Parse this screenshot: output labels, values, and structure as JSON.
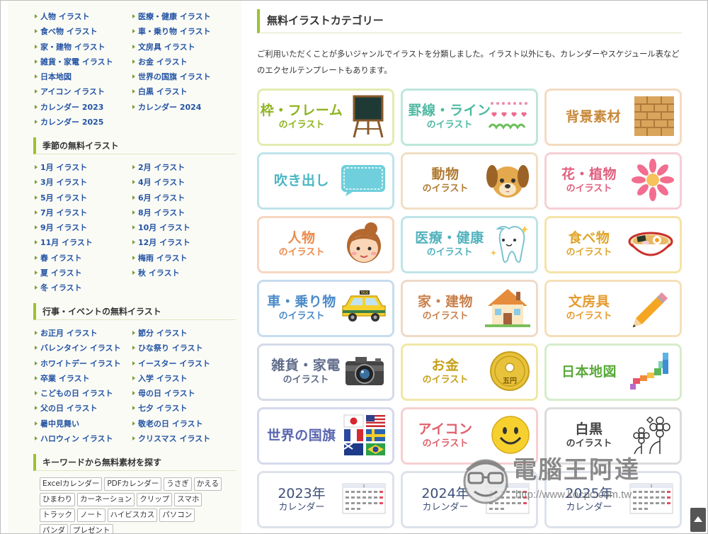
{
  "sidebar": {
    "top_links": [
      "人物 イラスト",
      "医療・健康 イラスト",
      "食べ物 イラスト",
      "車・乗り物 イラスト",
      "家・建物 イラスト",
      "文房具 イラスト",
      "雑貨・家電 イラスト",
      "お金 イラスト",
      "日本地図",
      "世界の国旗 イラスト",
      "アイコン イラスト",
      "白黒 イラスト",
      "カレンダー 2023",
      "カレンダー 2024",
      "カレンダー 2025"
    ],
    "season_title": "季節の無料イラスト",
    "season_links": [
      "1月 イラスト",
      "2月 イラスト",
      "3月 イラスト",
      "4月 イラスト",
      "5月 イラスト",
      "6月 イラスト",
      "7月 イラスト",
      "8月 イラスト",
      "9月 イラスト",
      "10月 イラスト",
      "11月 イラスト",
      "12月 イラスト",
      "春 イラスト",
      "梅雨 イラスト",
      "夏 イラスト",
      "秋 イラスト",
      "冬 イラスト"
    ],
    "event_title": "行事・イベントの無料イラスト",
    "event_links": [
      "お正月 イラスト",
      "節分 イラスト",
      "バレンタイン イラスト",
      "ひな祭り イラスト",
      "ホワイトデー イラスト",
      "イースター イラスト",
      "卒業 イラスト",
      "入学 イラスト",
      "こどもの日 イラスト",
      "母の日 イラスト",
      "父の日 イラスト",
      "七夕 イラスト",
      "暑中見舞い",
      "敬老の日 イラスト",
      "ハロウィン イラスト",
      "クリスマス イラスト"
    ],
    "keyword_title": "キーワードから無料素材を探す",
    "tags": [
      "Excelカレンダー",
      "PDFカレンダー",
      "うさぎ",
      "かえる",
      "ひまわり",
      "カーネーション",
      "クリップ",
      "スマホ",
      "トラック",
      "ノート",
      "ハイビスカス",
      "パソコン",
      "パンダ",
      "プレゼント"
    ]
  },
  "main": {
    "title": "無料イラストカテゴリー",
    "intro": "ご利用いただくことが多いジャンルでイラストを分類しました。イラスト以外にも、カレンダーやスケジュール表などのエクセルテンプレートもあります。",
    "cards": [
      {
        "title": "枠・フレーム",
        "sub": "のイラスト",
        "icon": "blackboard-icon",
        "border": "#e2ecb0",
        "color": "#8fb31f"
      },
      {
        "title": "罫線・ライン",
        "sub": "のイラスト",
        "icon": "line-border-icon",
        "border": "#bfe6dc",
        "color": "#4fb9a2"
      },
      {
        "title": "背景素材",
        "sub": "",
        "icon": "brick-wall-icon",
        "border": "#f3dcc2",
        "color": "#c8893a"
      },
      {
        "title": "吹き出し",
        "sub": "",
        "icon": "speech-bubble-icon",
        "border": "#bfe4ea",
        "color": "#4ab7c4"
      },
      {
        "title": "動物",
        "sub": "のイラスト",
        "icon": "dog-icon",
        "border": "#f0dfc4",
        "color": "#b07a33"
      },
      {
        "title": "花・植物",
        "sub": "のイラスト",
        "icon": "flower-icon",
        "border": "#f6cfd6",
        "color": "#e0607e"
      },
      {
        "title": "人物",
        "sub": "のイラスト",
        "icon": "person-icon",
        "border": "#f7d6c0",
        "color": "#ec8a4c"
      },
      {
        "title": "医療・健康",
        "sub": "のイラスト",
        "icon": "tooth-icon",
        "border": "#bfe4e8",
        "color": "#52b2bd"
      },
      {
        "title": "食べ物",
        "sub": "のイラスト",
        "icon": "ramen-icon",
        "border": "#f6e3a6",
        "color": "#e0a52a"
      },
      {
        "title": "車・乗り物",
        "sub": "のイラスト",
        "icon": "taxi-icon",
        "border": "#c6dcef",
        "color": "#4a8ac8"
      },
      {
        "title": "家・建物",
        "sub": "のイラスト",
        "icon": "house-icon",
        "border": "#f0d9c8",
        "color": "#c87f4a"
      },
      {
        "title": "文房具",
        "sub": "のイラスト",
        "icon": "pencil-icon",
        "border": "#f6dfb8",
        "color": "#e59a2d"
      },
      {
        "title": "雑貨・家電",
        "sub": "のイラスト",
        "icon": "camera-icon",
        "border": "#d5dbe8",
        "color": "#5f6c8a"
      },
      {
        "title": "お金",
        "sub": "のイラスト",
        "icon": "coin-icon",
        "border": "#f0e7a8",
        "color": "#c6a018"
      },
      {
        "title": "日本地図",
        "sub": "",
        "icon": "japan-map-icon",
        "border": "#d6eccb",
        "color": "#5aaa3a"
      },
      {
        "title": "世界の国旗",
        "sub": "",
        "icon": "flags-icon",
        "border": "#d6d9ee",
        "color": "#5a66b0"
      },
      {
        "title": "アイコン",
        "sub": "のイラスト",
        "icon": "smiley-icon",
        "border": "#f6cfd2",
        "color": "#e0606a"
      },
      {
        "title": "白黒",
        "sub": "のイラスト",
        "icon": "bw-flower-icon",
        "border": "#dcdcdc",
        "color": "#444444"
      },
      {
        "title": "2023年",
        "sub": "カレンダー",
        "icon": "calendar-icon",
        "border": "#dde2ea",
        "color": "#3d4f78"
      },
      {
        "title": "2024年",
        "sub": "カレンダー",
        "icon": "calendar-icon",
        "border": "#dde2ea",
        "color": "#3d4f78"
      },
      {
        "title": "2025年",
        "sub": "カレンダー",
        "icon": "calendar-icon",
        "border": "#dde2ea",
        "color": "#3d4f78"
      }
    ]
  },
  "watermark": {
    "text": "電腦王阿達",
    "url": "http://www.kocpc.com.tw"
  }
}
